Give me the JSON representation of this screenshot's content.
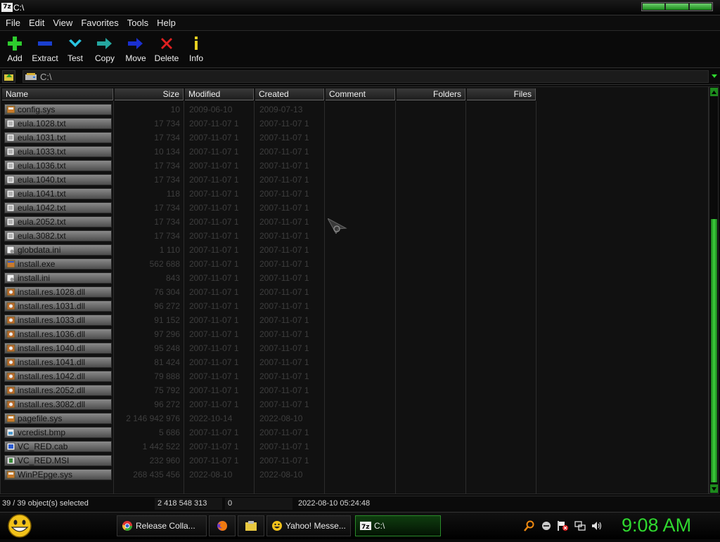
{
  "window": {
    "title": "C:\\",
    "app_icon": "7z"
  },
  "menu": [
    "File",
    "Edit",
    "View",
    "Favorites",
    "Tools",
    "Help"
  ],
  "toolbar": [
    {
      "label": "Add",
      "icon": "plus-icon",
      "color": "#2ecc2e"
    },
    {
      "label": "Extract",
      "icon": "minus-icon",
      "color": "#1a3fd0"
    },
    {
      "label": "Test",
      "icon": "check-icon",
      "color": "#29c4e0"
    },
    {
      "label": "Copy",
      "icon": "copy-arrow-icon",
      "color": "#25a7a0"
    },
    {
      "label": "Move",
      "icon": "move-arrow-icon",
      "color": "#1a2fd0"
    },
    {
      "label": "Delete",
      "icon": "x-icon",
      "color": "#e02020"
    },
    {
      "label": "Info",
      "icon": "info-icon",
      "color": "#e8d020"
    }
  ],
  "address": {
    "path": "C:\\"
  },
  "columns": [
    "Name",
    "Size",
    "Modified",
    "Created",
    "Comment",
    "Folders",
    "Files"
  ],
  "files": [
    {
      "name": "config.sys",
      "size": "10",
      "modified": "2009-06-10",
      "created": "2009-07-13",
      "icon": "sys-file-icon"
    },
    {
      "name": "eula.1028.txt",
      "size": "17 734",
      "modified": "2007-11-07 1",
      "created": "2007-11-07 1",
      "icon": "text-file-icon"
    },
    {
      "name": "eula.1031.txt",
      "size": "17 734",
      "modified": "2007-11-07 1",
      "created": "2007-11-07 1",
      "icon": "text-file-icon"
    },
    {
      "name": "eula.1033.txt",
      "size": "10 134",
      "modified": "2007-11-07 1",
      "created": "2007-11-07 1",
      "icon": "text-file-icon"
    },
    {
      "name": "eula.1036.txt",
      "size": "17 734",
      "modified": "2007-11-07 1",
      "created": "2007-11-07 1",
      "icon": "text-file-icon"
    },
    {
      "name": "eula.1040.txt",
      "size": "17 734",
      "modified": "2007-11-07 1",
      "created": "2007-11-07 1",
      "icon": "text-file-icon"
    },
    {
      "name": "eula.1041.txt",
      "size": "118",
      "modified": "2007-11-07 1",
      "created": "2007-11-07 1",
      "icon": "text-file-icon"
    },
    {
      "name": "eula.1042.txt",
      "size": "17 734",
      "modified": "2007-11-07 1",
      "created": "2007-11-07 1",
      "icon": "text-file-icon"
    },
    {
      "name": "eula.2052.txt",
      "size": "17 734",
      "modified": "2007-11-07 1",
      "created": "2007-11-07 1",
      "icon": "text-file-icon"
    },
    {
      "name": "eula.3082.txt",
      "size": "17 734",
      "modified": "2007-11-07 1",
      "created": "2007-11-07 1",
      "icon": "text-file-icon"
    },
    {
      "name": "globdata.ini",
      "size": "1 110",
      "modified": "2007-11-07 1",
      "created": "2007-11-07 1",
      "icon": "ini-file-icon"
    },
    {
      "name": "install.exe",
      "size": "562 688",
      "modified": "2007-11-07 1",
      "created": "2007-11-07 1",
      "icon": "exe-file-icon"
    },
    {
      "name": "install.ini",
      "size": "843",
      "modified": "2007-11-07 1",
      "created": "2007-11-07 1",
      "icon": "ini-file-icon"
    },
    {
      "name": "install.res.1028.dll",
      "size": "76 304",
      "modified": "2007-11-07 1",
      "created": "2007-11-07 1",
      "icon": "dll-file-icon"
    },
    {
      "name": "install.res.1031.dll",
      "size": "96 272",
      "modified": "2007-11-07 1",
      "created": "2007-11-07 1",
      "icon": "dll-file-icon"
    },
    {
      "name": "install.res.1033.dll",
      "size": "91 152",
      "modified": "2007-11-07 1",
      "created": "2007-11-07 1",
      "icon": "dll-file-icon"
    },
    {
      "name": "install.res.1036.dll",
      "size": "97 296",
      "modified": "2007-11-07 1",
      "created": "2007-11-07 1",
      "icon": "dll-file-icon"
    },
    {
      "name": "install.res.1040.dll",
      "size": "95 248",
      "modified": "2007-11-07 1",
      "created": "2007-11-07 1",
      "icon": "dll-file-icon"
    },
    {
      "name": "install.res.1041.dll",
      "size": "81 424",
      "modified": "2007-11-07 1",
      "created": "2007-11-07 1",
      "icon": "dll-file-icon"
    },
    {
      "name": "install.res.1042.dll",
      "size": "79 888",
      "modified": "2007-11-07 1",
      "created": "2007-11-07 1",
      "icon": "dll-file-icon"
    },
    {
      "name": "install.res.2052.dll",
      "size": "75 792",
      "modified": "2007-11-07 1",
      "created": "2007-11-07 1",
      "icon": "dll-file-icon"
    },
    {
      "name": "install.res.3082.dll",
      "size": "96 272",
      "modified": "2007-11-07 1",
      "created": "2007-11-07 1",
      "icon": "dll-file-icon"
    },
    {
      "name": "pagefile.sys",
      "size": "2 146 942 976",
      "modified": "2022-10-14",
      "created": "2022-08-10",
      "icon": "sys-file-icon"
    },
    {
      "name": "vcredist.bmp",
      "size": "5 686",
      "modified": "2007-11-07 1",
      "created": "2007-11-07 1",
      "icon": "bmp-file-icon"
    },
    {
      "name": "VC_RED.cab",
      "size": "1 442 522",
      "modified": "2007-11-07 1",
      "created": "2007-11-07 1",
      "icon": "cab-file-icon"
    },
    {
      "name": "VC_RED.MSI",
      "size": "232 960",
      "modified": "2007-11-07 1",
      "created": "2007-11-07 1",
      "icon": "msi-file-icon"
    },
    {
      "name": "WinPEpge.sys",
      "size": "268 435 456",
      "modified": "2022-08-10",
      "created": "2022-08-10",
      "icon": "sys-file-icon"
    }
  ],
  "status": {
    "selected": "39 / 39 object(s) selected",
    "total_size": "2 418 548 313",
    "packed": "0",
    "date": "2022-08-10 05:24:48"
  },
  "taskbar": {
    "tasks": [
      {
        "label": "Release Colla...",
        "icon": "chrome-icon"
      },
      {
        "label": "",
        "icon": "firefox-icon"
      },
      {
        "label": "",
        "icon": "folder-icon"
      },
      {
        "label": "Yahoo! Messe...",
        "icon": "yahoo-messenger-icon"
      },
      {
        "label": "C:\\",
        "icon": "7zip-icon",
        "active": true
      }
    ],
    "clock": "9:08 AM"
  },
  "colors": {
    "accent": "#2fd82f",
    "background": "#0a0a0a"
  }
}
